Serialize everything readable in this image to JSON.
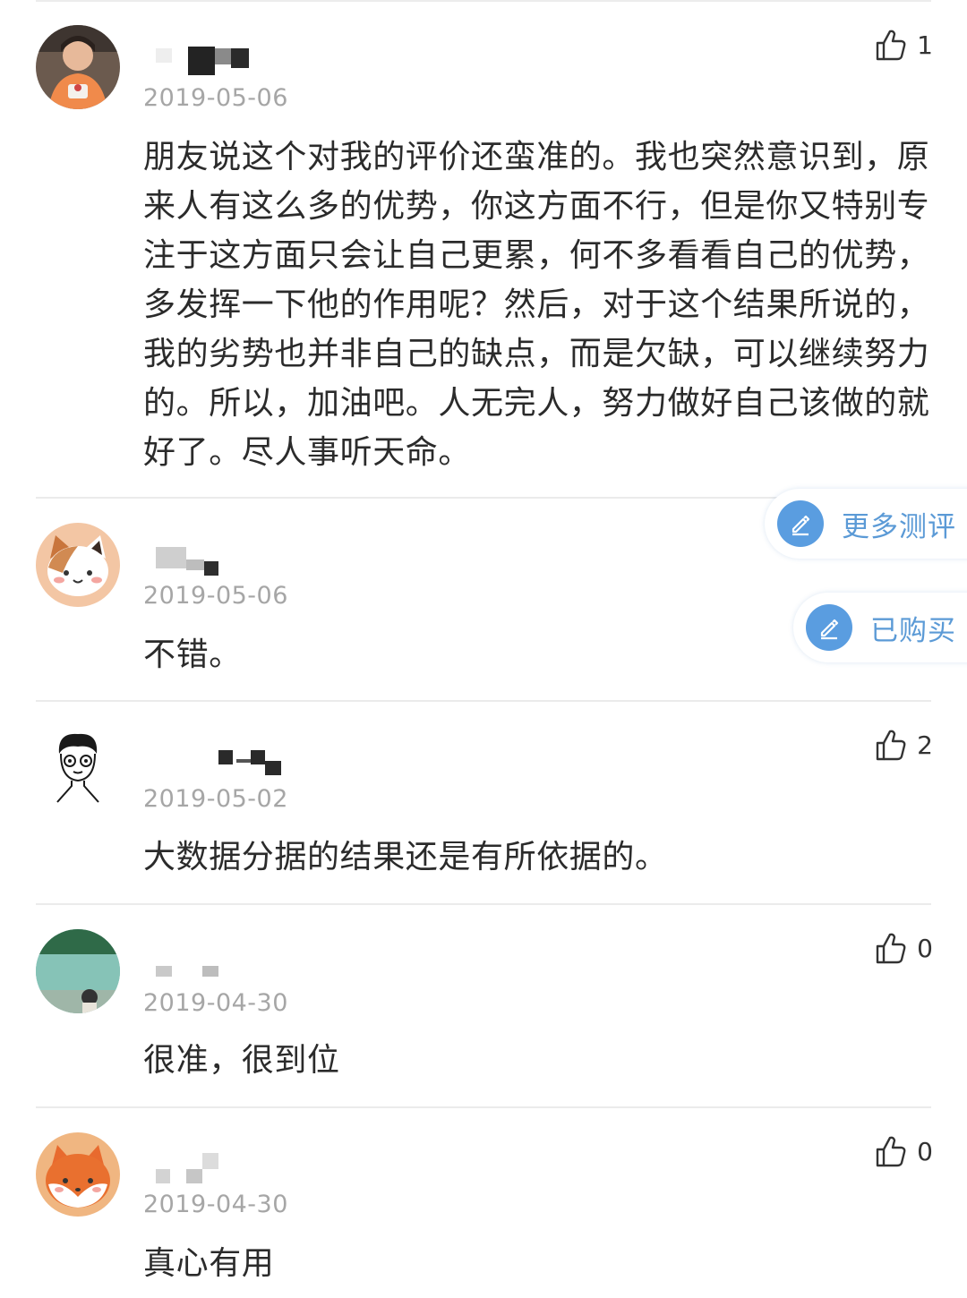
{
  "comments": [
    {
      "date": "2019-05-06",
      "text": "朋友说这个对我的评价还蛮准的。我也突然意识到，原来人有这么多的优势，你这方面不行，但是你又特别专注于这方面只会让自己更累，何不多看看自己的优势，多发挥一下他的作用呢？然后，对于这个结果所说的，我的劣势也并非自己的缺点，而是欠缺，可以继续努力的。所以，加油吧。人无完人，努力做好自己该做的就好了。尽人事听天命。",
      "likes": "1",
      "avatar_icon": "user-photo-avatar"
    },
    {
      "date": "2019-05-06",
      "text": "不错。",
      "avatar_icon": "cat-avatar"
    },
    {
      "date": "2019-05-02",
      "text": "大数据分据的结果还是有所依据的。",
      "likes": "2",
      "avatar_icon": "cartoon-boy-avatar"
    },
    {
      "date": "2019-04-30",
      "text": "很准，很到位",
      "likes": "0",
      "avatar_icon": "scenery-photo-avatar"
    },
    {
      "date": "2019-04-30",
      "text": "真心有用",
      "likes": "0",
      "avatar_icon": "fox-avatar"
    }
  ],
  "floating_buttons": {
    "more_reviews": "更多测评",
    "purchased": "已购买",
    "icon": "pencil-icon"
  },
  "icons": {
    "like": "thumbs-up-icon"
  },
  "colors": {
    "accent": "#5a9de0",
    "accent_text": "#5b9ad6",
    "date": "#a6a6a6",
    "text": "#2b2b2b",
    "divider": "#ebebeb"
  }
}
